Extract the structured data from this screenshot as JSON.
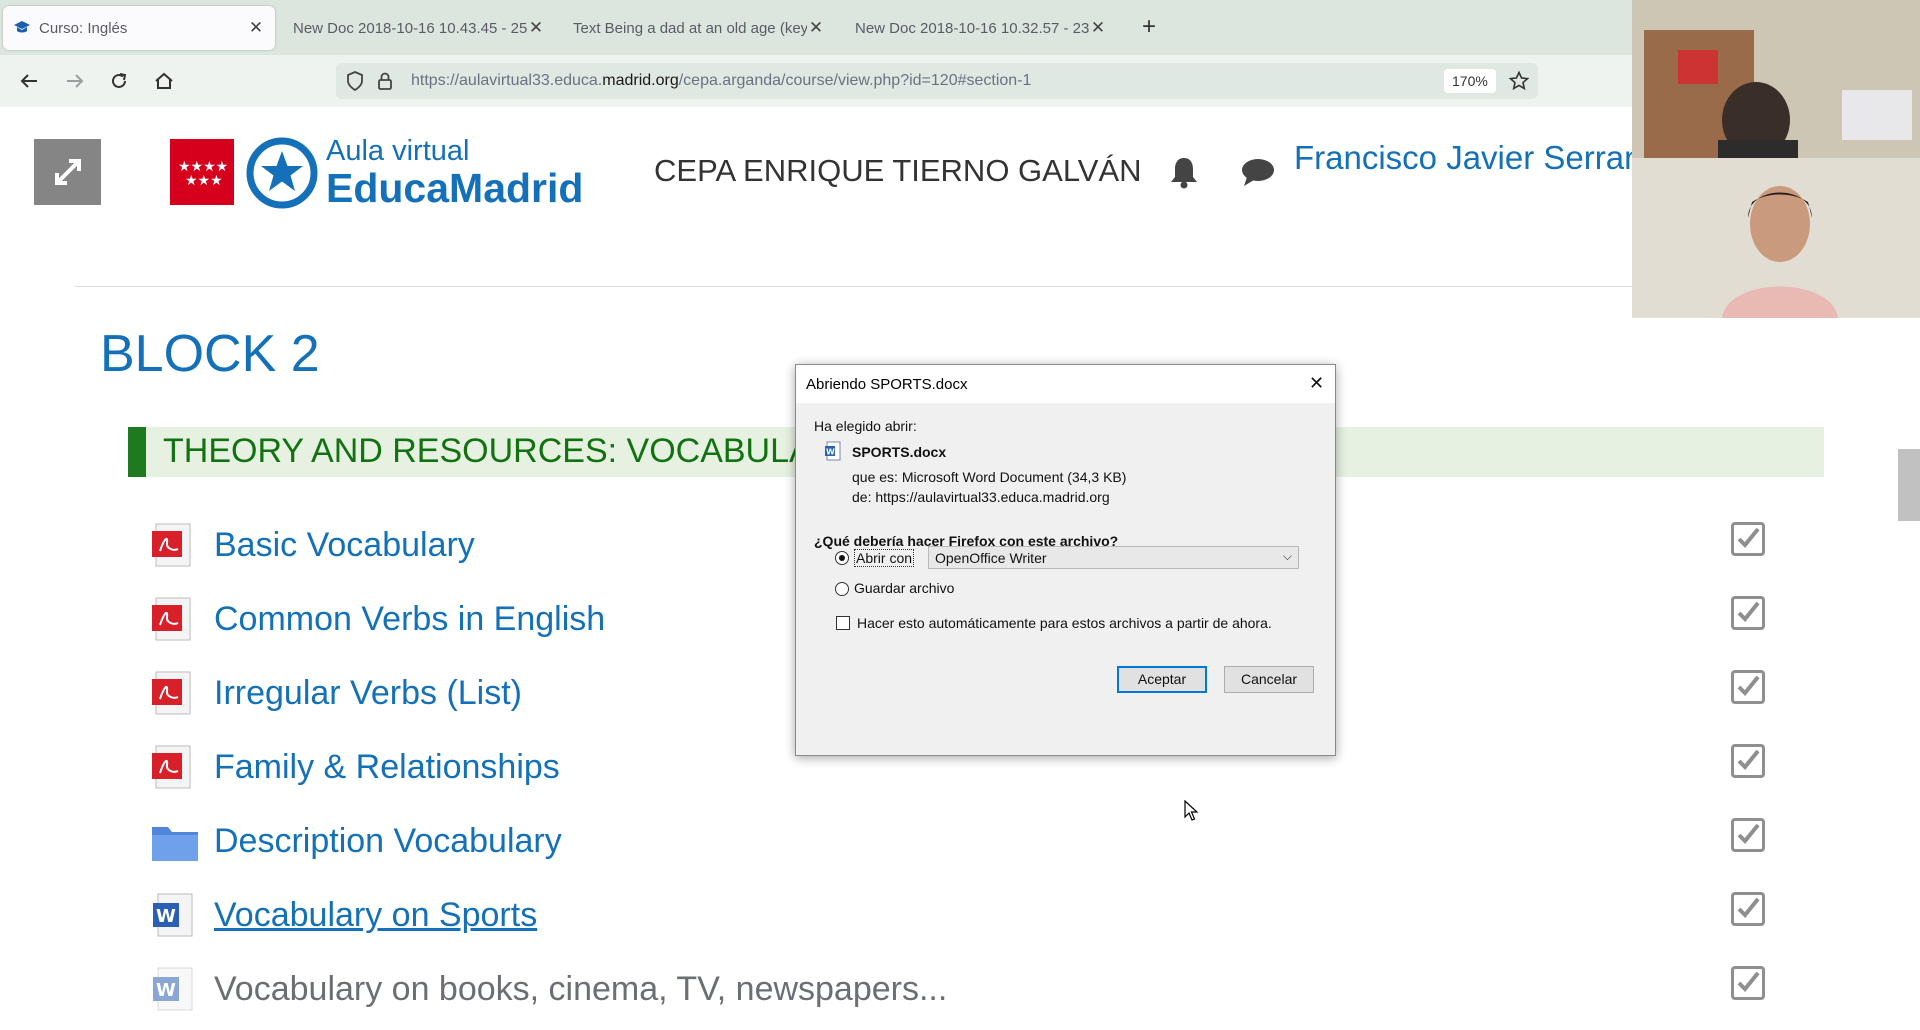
{
  "browser": {
    "tabs": [
      {
        "label": "Curso: Inglés",
        "active": true
      },
      {
        "label": "New Doc 2018-10-16 10.43.45 - 25",
        "active": false
      },
      {
        "label": "Text Being a dad at an old age (key",
        "active": false
      },
      {
        "label": "New Doc 2018-10-16 10.32.57 - 23",
        "active": false
      }
    ],
    "new_tab_label": "+",
    "url_prefix": "https://aulavirtual33.educa.",
    "url_domain": "madrid.org",
    "url_path": "/cepa.arganda/course/view.php?id=120#section-1",
    "zoom": "170%"
  },
  "header": {
    "aula_label": "Aula virtual",
    "brand_label": "EducaMadrid",
    "center_name": "CEPA ENRIQUE TIERNO GALVÁN",
    "user_name": "Francisco Javier Serrano"
  },
  "course": {
    "block_title": "BLOCK 2",
    "section_title": "THEORY AND RESOURCES: VOCABULARY",
    "activities": [
      {
        "label": "Basic Vocabulary",
        "icon": "pdf-icon"
      },
      {
        "label": "Common Verbs in English",
        "icon": "pdf-icon"
      },
      {
        "label": "Irregular Verbs (List)",
        "icon": "pdf-icon"
      },
      {
        "label": "Family & Relationships",
        "icon": "pdf-icon"
      },
      {
        "label": "Description Vocabulary",
        "icon": "folder-icon"
      },
      {
        "label": "Vocabulary on Sports",
        "icon": "word-doc-icon"
      },
      {
        "label": "Vocabulary on books, cinema, TV, newspapers...",
        "icon": "word-doc-icon"
      }
    ]
  },
  "dialog": {
    "title": "Abriendo SPORTS.docx",
    "chosen_label": "Ha elegido abrir:",
    "filename": "SPORTS.docx",
    "type_line": "que es: Microsoft Word Document (34,3 KB)",
    "from_line": "de: https://aulavirtual33.educa.madrid.org",
    "question": "¿Qué debería hacer Firefox con este archivo?",
    "open_with_label": "Abrir con",
    "open_with_value": "OpenOffice Writer",
    "save_label": "Guardar archivo",
    "auto_label": "Hacer esto automáticamente para estos archivos a partir de ahora.",
    "ok_label": "Aceptar",
    "cancel_label": "Cancelar"
  },
  "colors": {
    "brand_blue": "#1470b8",
    "section_green": "#127212",
    "madrid_red": "#d6001c"
  }
}
